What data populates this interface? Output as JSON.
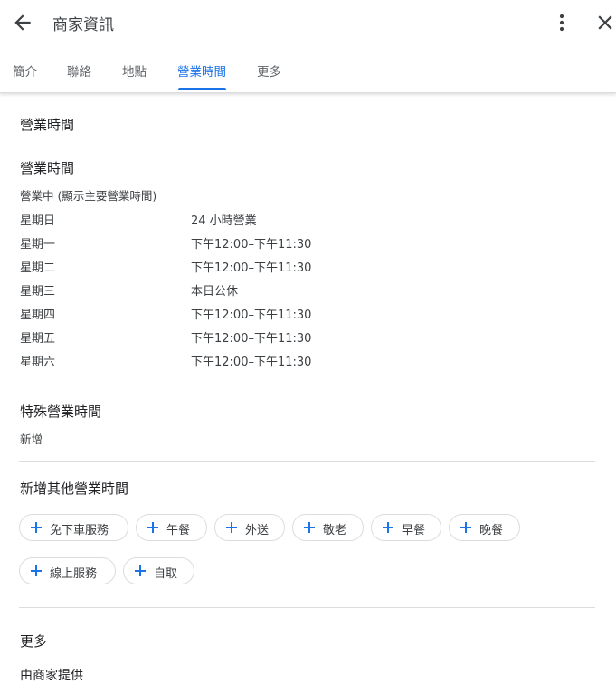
{
  "header": {
    "title": "商家資訊",
    "back_icon": "arrow-left-icon",
    "more_icon": "more-vertical-icon",
    "close_icon": "close-icon"
  },
  "tabs": [
    {
      "label": "簡介"
    },
    {
      "label": "聯絡"
    },
    {
      "label": "地點"
    },
    {
      "label": "營業時間",
      "active": true
    },
    {
      "label": "更多"
    }
  ],
  "colors": {
    "accent": "#1a73e8",
    "text": "#202124",
    "secondary": "#5f6368",
    "divider": "#dadce0"
  },
  "section_title": "營業時間",
  "hours": {
    "heading": "營業時間",
    "status": "營業中 (顯示主要營業時間)",
    "days": [
      {
        "day": "星期日",
        "hours": "24 小時營業"
      },
      {
        "day": "星期一",
        "hours": "下午12:00–下午11:30"
      },
      {
        "day": "星期二",
        "hours": "下午12:00–下午11:30"
      },
      {
        "day": "星期三",
        "hours": "本日公休"
      },
      {
        "day": "星期四",
        "hours": "下午12:00–下午11:30"
      },
      {
        "day": "星期五",
        "hours": "下午12:00–下午11:30"
      },
      {
        "day": "星期六",
        "hours": "下午12:00–下午11:30"
      }
    ]
  },
  "special_hours": {
    "heading": "特殊營業時間",
    "add_link": "新增"
  },
  "other_hours": {
    "heading": "新增其他營業時間",
    "chips": [
      "免下車服務",
      "午餐",
      "外送",
      "敬老",
      "早餐",
      "晚餐",
      "線上服務",
      "自取"
    ],
    "chip_icon": "plus-icon"
  },
  "more": {
    "heading": "更多",
    "provided_by": "由商家提供"
  }
}
